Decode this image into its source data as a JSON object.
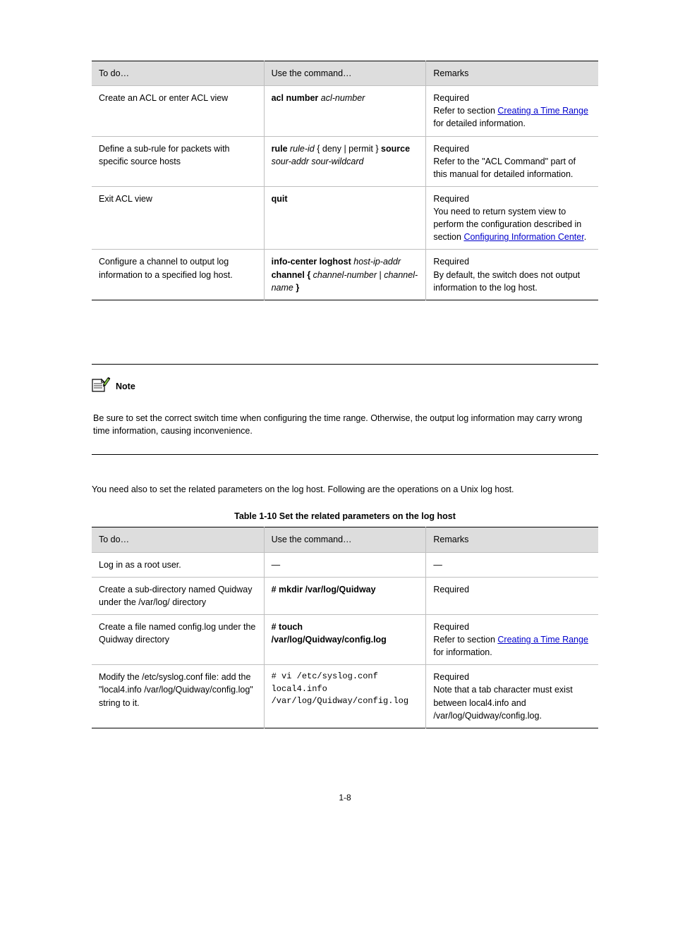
{
  "page_number": "1-8",
  "table1": {
    "headers": [
      "To do…",
      "Use the command…",
      "Remarks"
    ],
    "rows": [
      [
        {
          "plain": "Create an ACL or enter ACL view"
        },
        {
          "cmd": "acl number",
          "ital": "acl-number"
        },
        {
          "pre": "Required\nRefer to section ",
          "link": "Creating a Time Range",
          "post": " for detailed information."
        }
      ],
      [
        {
          "plain": "Define a sub-rule for packets with specific source hosts"
        },
        {
          "cmd1": "rule",
          "ital1": " rule-id ",
          "alt": "{ deny | permit }",
          "cmd2": " source",
          "ital2": " sour-addr sour-wildcard"
        },
        {
          "plain": "Required\nRefer to the \"ACL Command\" part of this manual for detailed information."
        }
      ],
      [
        {
          "plain": "Exit ACL view"
        },
        {
          "cmd": "quit"
        },
        {
          "pre": "Required\nYou need to return system view to perform the configuration described in section ",
          "link": "Configuring Information Center",
          "post": "."
        }
      ],
      [
        {
          "plain": "Configure a channel to output log information to a specified log host."
        },
        {
          "cmd1": "info-center loghost ",
          "ital1": "host-ip-addr",
          "cmd2": " channel { ",
          "ital2": "channel-number",
          "alt": " | ",
          "ital3": "channel-name",
          "cmd3": " }"
        },
        {
          "plain": "Required\nBy default, the switch does not output information to the log host."
        }
      ]
    ]
  },
  "note": {
    "label": "Note",
    "body": "Be sure to set the correct switch time when configuring the time range. Otherwise, the output log information may carry wrong time information, causing inconvenience."
  },
  "intro_para": "You need also to set the related parameters on the log host. Following are the operations on a Unix log host.",
  "table2": {
    "caption": "Table 1-10 Set the related parameters on the log host",
    "headers": [
      "To do…",
      "Use the command…",
      "Remarks"
    ],
    "rows": [
      [
        {
          "plain": "Log in as a root user."
        },
        {
          "plain": "—"
        },
        {
          "plain": "—"
        }
      ],
      [
        {
          "plain": "Create a sub-directory named Quidway under the /var/log/ directory"
        },
        {
          "cmd": "# mkdir /var/log/Quidway"
        },
        {
          "plain": "Required"
        }
      ],
      [
        {
          "plain": "Create a file named config.log under the Quidway directory"
        },
        {
          "cmd": "# touch /var/log/Quidway/config.log"
        },
        {
          "pre": "Required\nRefer to section ",
          "link": "Creating a Time Range",
          "post": " for information."
        }
      ],
      [
        {
          "plain": "Modify the /etc/syslog.conf file: add the \"local4.info /var/log/Quidway/config.log\" string to it."
        },
        {
          "mono": "# vi  /etc/syslog.conf\nlocal4.info \n/var/log/Quidway/config.log"
        },
        {
          "plain": "Required\nNote that a tab character must exist between local4.info and /var/log/Quidway/config.log."
        }
      ]
    ]
  }
}
